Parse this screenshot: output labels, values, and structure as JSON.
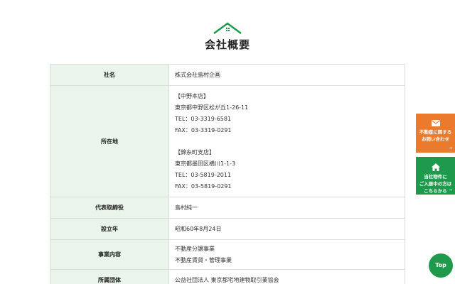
{
  "page": {
    "title": "会社概要"
  },
  "table": {
    "rows": [
      {
        "label": "社名",
        "lines": [
          "株式会社島村企画"
        ]
      },
      {
        "label": "所在地",
        "lines": [
          "【中野本店】",
          "東京都中野区松が丘1-26-11",
          "TEL：03-3319-6581",
          "FAX：03-3319-0291",
          "",
          "【錦糸町支店】",
          "東京都墨田区横川1-1-3",
          "TEL：03-5819-2011",
          "FAX：03-5819-0291"
        ]
      },
      {
        "label": "代表取締役",
        "lines": [
          "島村純一"
        ]
      },
      {
        "label": "設立年",
        "lines": [
          "昭和60年8月24日"
        ]
      },
      {
        "label": "事業内容",
        "lines": [
          "不動産分譲事業",
          "不動産賃貸・管理事業"
        ]
      },
      {
        "label": "所属団体",
        "lines": [
          "公益社団法人 東京都宅地建物取引業協会"
        ]
      }
    ]
  },
  "side": {
    "contact_label": "不動産に関する\nお問い合わせ",
    "tenant_label": "当社物件に\nご入居中の方は\nこちらから",
    "top_label": "Top"
  },
  "colors": {
    "accent_green": "#1f9a4c",
    "accent_orange": "#ec7a2d",
    "header_cell_bg": "#eaf4ea",
    "border": "#dcdcdc"
  },
  "icons": [
    "house-icon",
    "mail-icon",
    "home-icon"
  ]
}
